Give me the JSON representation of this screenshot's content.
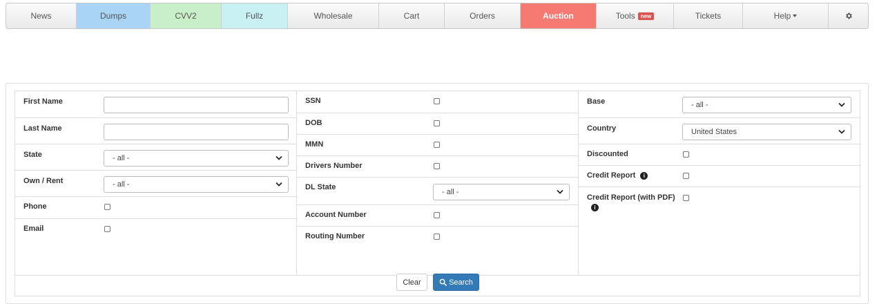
{
  "nav": {
    "tabs": [
      "News",
      "Dumps",
      "CVV2",
      "Fullz",
      "Wholesale",
      "Cart",
      "Orders",
      "Auction",
      "Tools",
      "Tickets",
      "Help"
    ],
    "tools_badge": "new"
  },
  "form": {
    "col1": {
      "first_name": "First Name",
      "last_name": "Last Name",
      "state": "State",
      "state_value": "- all -",
      "own_rent": "Own / Rent",
      "own_rent_value": "- all -",
      "phone": "Phone",
      "email": "Email"
    },
    "col2": {
      "ssn": "SSN",
      "dob": "DOB",
      "mmn": "MMN",
      "drivers_number": "Drivers Number",
      "dl_state": "DL State",
      "dl_state_value": "- all -",
      "account_number": "Account Number",
      "routing_number": "Routing Number"
    },
    "col3": {
      "base": "Base",
      "base_value": "- all -",
      "country": "Country",
      "country_value": "United States",
      "discounted": "Discounted",
      "credit_report": "Credit Report",
      "credit_report_pdf": "Credit Report (with PDF)"
    }
  },
  "buttons": {
    "clear": "Clear",
    "search": "Search"
  },
  "colors": {
    "dumps": "#a9d4f6",
    "cvv2": "#c8efc8",
    "fullz": "#c9f0f3",
    "auction": "#f47a72",
    "search_button": "#337ab7"
  }
}
